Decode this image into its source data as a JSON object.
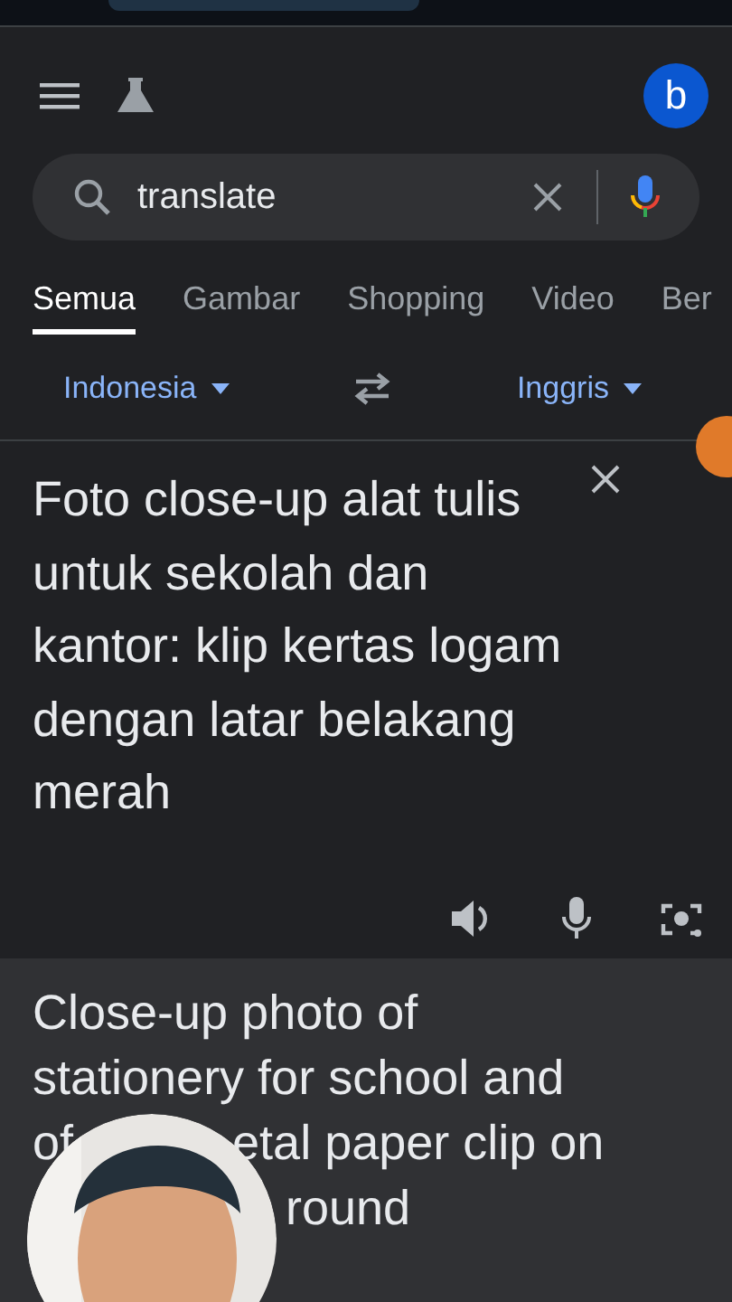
{
  "search": {
    "value": "translate"
  },
  "tabs": [
    {
      "label": "Semua",
      "selected": true
    },
    {
      "label": "Gambar",
      "selected": false
    },
    {
      "label": "Shopping",
      "selected": false
    },
    {
      "label": "Video",
      "selected": false
    },
    {
      "label": "Ber",
      "selected": false
    }
  ],
  "avatar": {
    "letter": "b"
  },
  "languages": {
    "source": "Indonesia",
    "target": "Inggris"
  },
  "source_text": "Foto close-up alat tulis untuk sekolah dan kantor: klip kertas logam dengan latar belakang merah",
  "translation_lines": [
    {
      "pieces": [
        "Close-up photo of"
      ]
    },
    {
      "pieces": [
        "stationery for school and"
      ]
    },
    {
      "pieces": [
        "of",
        "etal paper clip on"
      ]
    },
    {
      "pieces": [
        "round"
      ],
      "indent": true
    }
  ]
}
